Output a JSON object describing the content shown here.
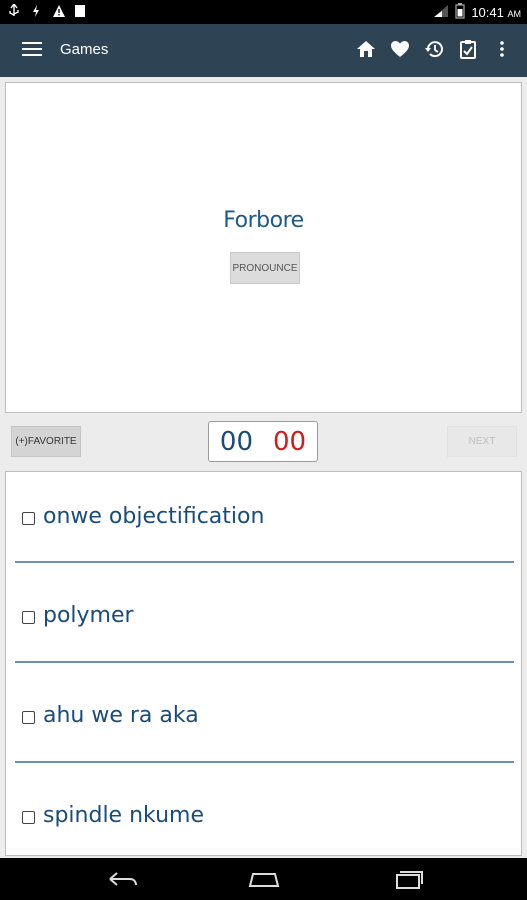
{
  "status_bar": {
    "time": "10:41",
    "ampm": "AM",
    "icons": [
      "usb-icon",
      "bolt-icon",
      "warning-icon",
      "image-icon",
      "signal-icon",
      "battery-icon"
    ]
  },
  "toolbar": {
    "title": "Games",
    "actions": [
      "home-icon",
      "heart-icon",
      "history-icon",
      "clipboard-icon",
      "more-vert-icon"
    ]
  },
  "card": {
    "word": "Forbore",
    "pronounce_label": "PRONOUNCE"
  },
  "controls": {
    "favorite_label": "(+)FAVORITE",
    "correct_count": "00",
    "wrong_count": "00",
    "next_label": "NEXT"
  },
  "options": [
    {
      "text": "onwe objectification",
      "checked": false
    },
    {
      "text": "polymer",
      "checked": false
    },
    {
      "text": "ahu we ra aka",
      "checked": false
    },
    {
      "text": "spindle nkume",
      "checked": false
    }
  ],
  "colors": {
    "toolbar": "#2e4354",
    "word": "#1d5a86",
    "correct": "#1a4c7a",
    "wrong": "#d11b1b",
    "divider": "#6e90b0"
  }
}
